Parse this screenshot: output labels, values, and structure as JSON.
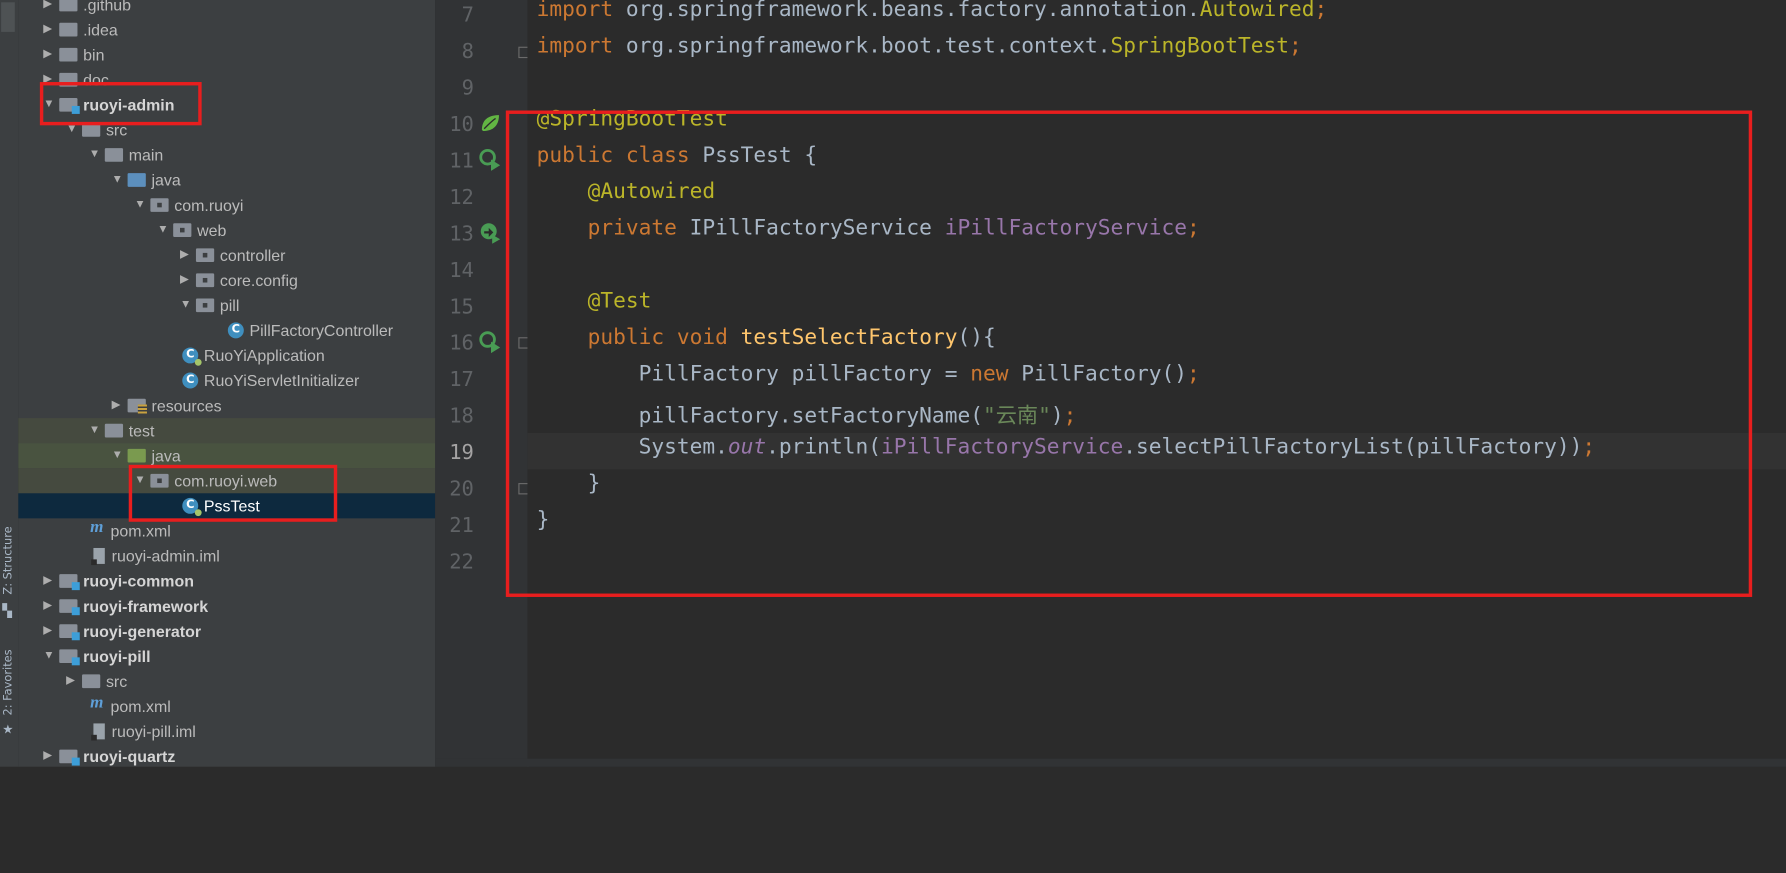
{
  "sidebar": {
    "structure_label": "Z: Structure",
    "favorites_label": "2: Favorites"
  },
  "tree": {
    "items": [
      {
        "label": ".github"
      },
      {
        "label": ".idea"
      },
      {
        "label": "bin"
      },
      {
        "label": "doc"
      },
      {
        "label": "ruoyi-admin"
      },
      {
        "label": "src"
      },
      {
        "label": "main"
      },
      {
        "label": "java"
      },
      {
        "label": "com.ruoyi"
      },
      {
        "label": "web"
      },
      {
        "label": "controller"
      },
      {
        "label": "core.config"
      },
      {
        "label": "pill"
      },
      {
        "label": "PillFactoryController"
      },
      {
        "label": "RuoYiApplication"
      },
      {
        "label": "RuoYiServletInitializer"
      },
      {
        "label": "resources"
      },
      {
        "label": "test"
      },
      {
        "label": "java"
      },
      {
        "label": "com.ruoyi.web"
      },
      {
        "label": "PssTest"
      },
      {
        "label": "pom.xml"
      },
      {
        "label": "ruoyi-admin.iml"
      },
      {
        "label": "ruoyi-common"
      },
      {
        "label": "ruoyi-framework"
      },
      {
        "label": "ruoyi-generator"
      },
      {
        "label": "ruoyi-pill"
      },
      {
        "label": "src"
      },
      {
        "label": "pom.xml"
      },
      {
        "label": "ruoyi-pill.iml"
      },
      {
        "label": "ruoyi-quartz"
      }
    ]
  },
  "editor": {
    "line_numbers": [
      "7",
      "8",
      "9",
      "10",
      "11",
      "12",
      "13",
      "14",
      "15",
      "16",
      "17",
      "18",
      "19",
      "20",
      "21",
      "22"
    ],
    "current_line": "19",
    "lines": {
      "l7": {
        "kw": "import ",
        "pkg": "org.springframework.beans.factory.annotation.",
        "cls": "Autowired",
        "semi": ";"
      },
      "l8": {
        "kw": "import ",
        "pkg": "org.springframework.boot.test.context.",
        "cls": "SpringBootTest",
        "semi": ";"
      },
      "l10": {
        "ann": "@SpringBootTest"
      },
      "l11": {
        "kw": "public class ",
        "name": "PssTest {"
      },
      "l12": {
        "ann": "@Autowired"
      },
      "l13": {
        "kw": "private ",
        "type": "IPillFactoryService ",
        "field": "iPillFactoryService",
        "semi": ";"
      },
      "l15": {
        "ann": "@Test"
      },
      "l16": {
        "kw": "public void ",
        "method": "testSelectFactory",
        "rest": "(){"
      },
      "l17": {
        "a": "PillFactory pillFactory = ",
        "kw": "new ",
        "b": "PillFactory()",
        "semi": ";"
      },
      "l18": {
        "a": "pillFactory.setFactoryName(",
        "str": "\"云南\"",
        "b": ")",
        "semi": ";"
      },
      "l19": {
        "a": "System.",
        "out": "out",
        "b": ".println(",
        "field": "iPillFactoryService",
        "c": ".selectPillFactoryList(pillFactory))",
        "semi": ";"
      },
      "l20": {
        "text": "}"
      },
      "l21": {
        "text": "}"
      }
    }
  },
  "colors": {
    "highlight_box": "#e81e1e",
    "keyword": "#cc7832",
    "annotation": "#bbb529",
    "field": "#9876aa",
    "method": "#ffc66d",
    "string": "#6a8759"
  }
}
